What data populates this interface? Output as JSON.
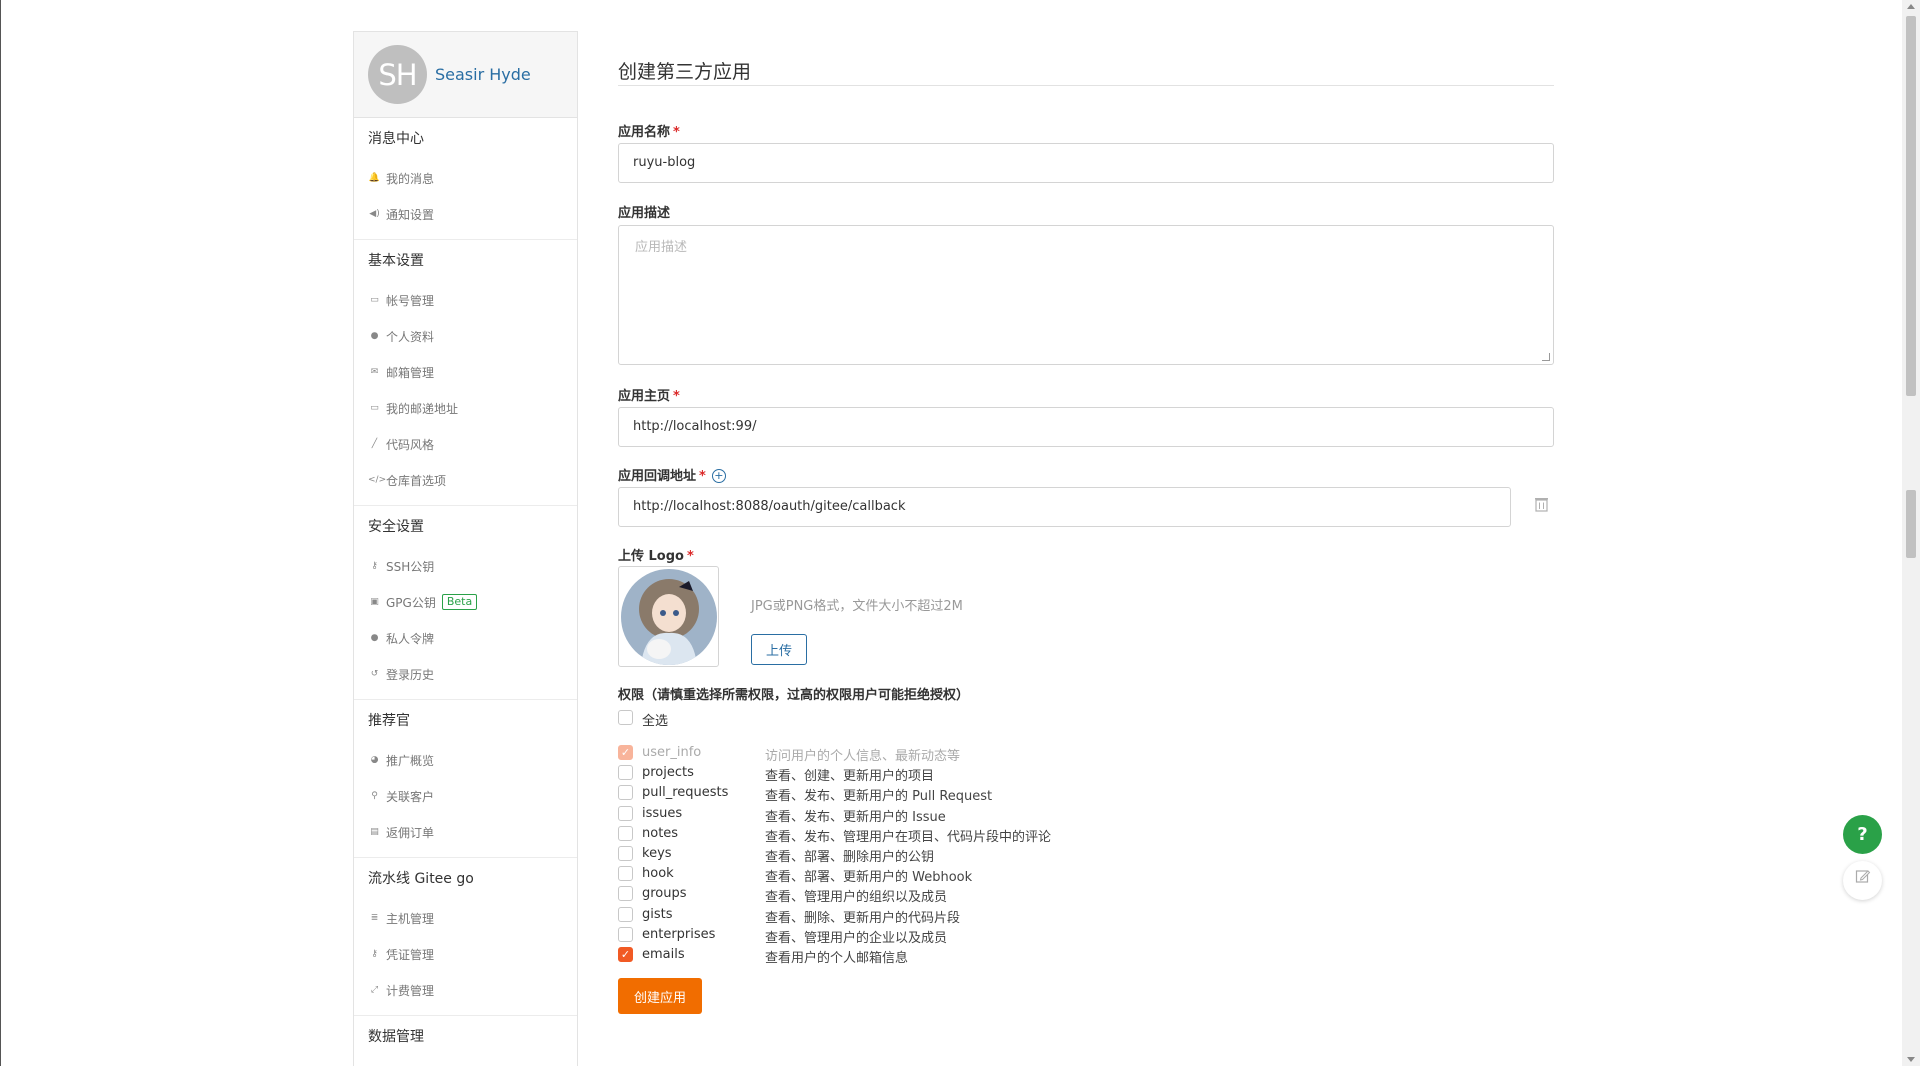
{
  "user": {
    "initials": "SH",
    "name": "Seasir Hyde"
  },
  "sidebar": {
    "sections": [
      {
        "title": "消息中心",
        "items": [
          {
            "label": "我的消息",
            "icon": "bell-icon"
          },
          {
            "label": "通知设置",
            "icon": "volume-icon"
          }
        ]
      },
      {
        "title": "基本设置",
        "items": [
          {
            "label": "帐号管理",
            "icon": "id-card-icon"
          },
          {
            "label": "个人资料",
            "icon": "user-icon"
          },
          {
            "label": "邮箱管理",
            "icon": "envelope-icon"
          },
          {
            "label": "我的邮递地址",
            "icon": "address-card-icon"
          },
          {
            "label": "代码风格",
            "icon": "brush-icon"
          },
          {
            "label": "仓库首选项",
            "icon": "code-icon"
          }
        ]
      },
      {
        "title": "安全设置",
        "items": [
          {
            "label": "SSH公钥",
            "icon": "key-icon"
          },
          {
            "label": "GPG公钥",
            "icon": "lock-icon",
            "badge": "Beta"
          },
          {
            "label": "私人令牌",
            "icon": "user-secret-icon"
          },
          {
            "label": "登录历史",
            "icon": "history-icon"
          }
        ]
      },
      {
        "title": "推荐官",
        "items": [
          {
            "label": "推广概览",
            "icon": "dashboard-icon"
          },
          {
            "label": "关联客户",
            "icon": "user-plus-icon"
          },
          {
            "label": "返佣订单",
            "icon": "receipt-icon"
          }
        ]
      },
      {
        "title": "流水线 Gitee go",
        "items": [
          {
            "label": "主机管理",
            "icon": "server-icon"
          },
          {
            "label": "凭证管理",
            "icon": "key-icon"
          },
          {
            "label": "计费管理",
            "icon": "expand-icon"
          }
        ]
      },
      {
        "title": "数据管理",
        "items": []
      }
    ]
  },
  "form": {
    "title": "创建第三方应用",
    "app_name": {
      "label": "应用名称",
      "value": "ruyu-blog"
    },
    "app_desc": {
      "label": "应用描述",
      "placeholder": "应用描述"
    },
    "homepage": {
      "label": "应用主页",
      "value": "http://localhost:99/"
    },
    "callback": {
      "label": "应用回调地址",
      "value": "http://localhost:8088/oauth/gitee/callback"
    },
    "logo": {
      "label": "上传 Logo",
      "hint": "JPG或PNG格式，文件大小不超过2M",
      "upload_label": "上传"
    },
    "permissions": {
      "title": "权限（请慎重选择所需权限，过高的权限用户可能拒绝授权）",
      "select_all": "全选",
      "items": [
        {
          "name": "user_info",
          "desc": "访问用户的个人信息、最新动态等",
          "checked": true,
          "disabled": true
        },
        {
          "name": "projects",
          "desc": "查看、创建、更新用户的项目",
          "checked": false
        },
        {
          "name": "pull_requests",
          "desc": "查看、发布、更新用户的 Pull Request",
          "checked": false
        },
        {
          "name": "issues",
          "desc": "查看、发布、更新用户的 Issue",
          "checked": false
        },
        {
          "name": "notes",
          "desc": "查看、发布、管理用户在项目、代码片段中的评论",
          "checked": false
        },
        {
          "name": "keys",
          "desc": "查看、部署、删除用户的公钥",
          "checked": false
        },
        {
          "name": "hook",
          "desc": "查看、部署、更新用户的 Webhook",
          "checked": false
        },
        {
          "name": "groups",
          "desc": "查看、管理用户的组织以及成员",
          "checked": false
        },
        {
          "name": "gists",
          "desc": "查看、删除、更新用户的代码片段",
          "checked": false
        },
        {
          "name": "enterprises",
          "desc": "查看、管理用户的企业以及成员",
          "checked": false
        },
        {
          "name": "emails",
          "desc": "查看用户的个人邮箱信息",
          "checked": true
        }
      ]
    },
    "submit_label": "创建应用"
  },
  "floating": {
    "help_label": "?"
  },
  "colors": {
    "accent": "#f16d00",
    "link": "#2a6ea3",
    "required": "#db2828",
    "green": "#2aa148"
  }
}
